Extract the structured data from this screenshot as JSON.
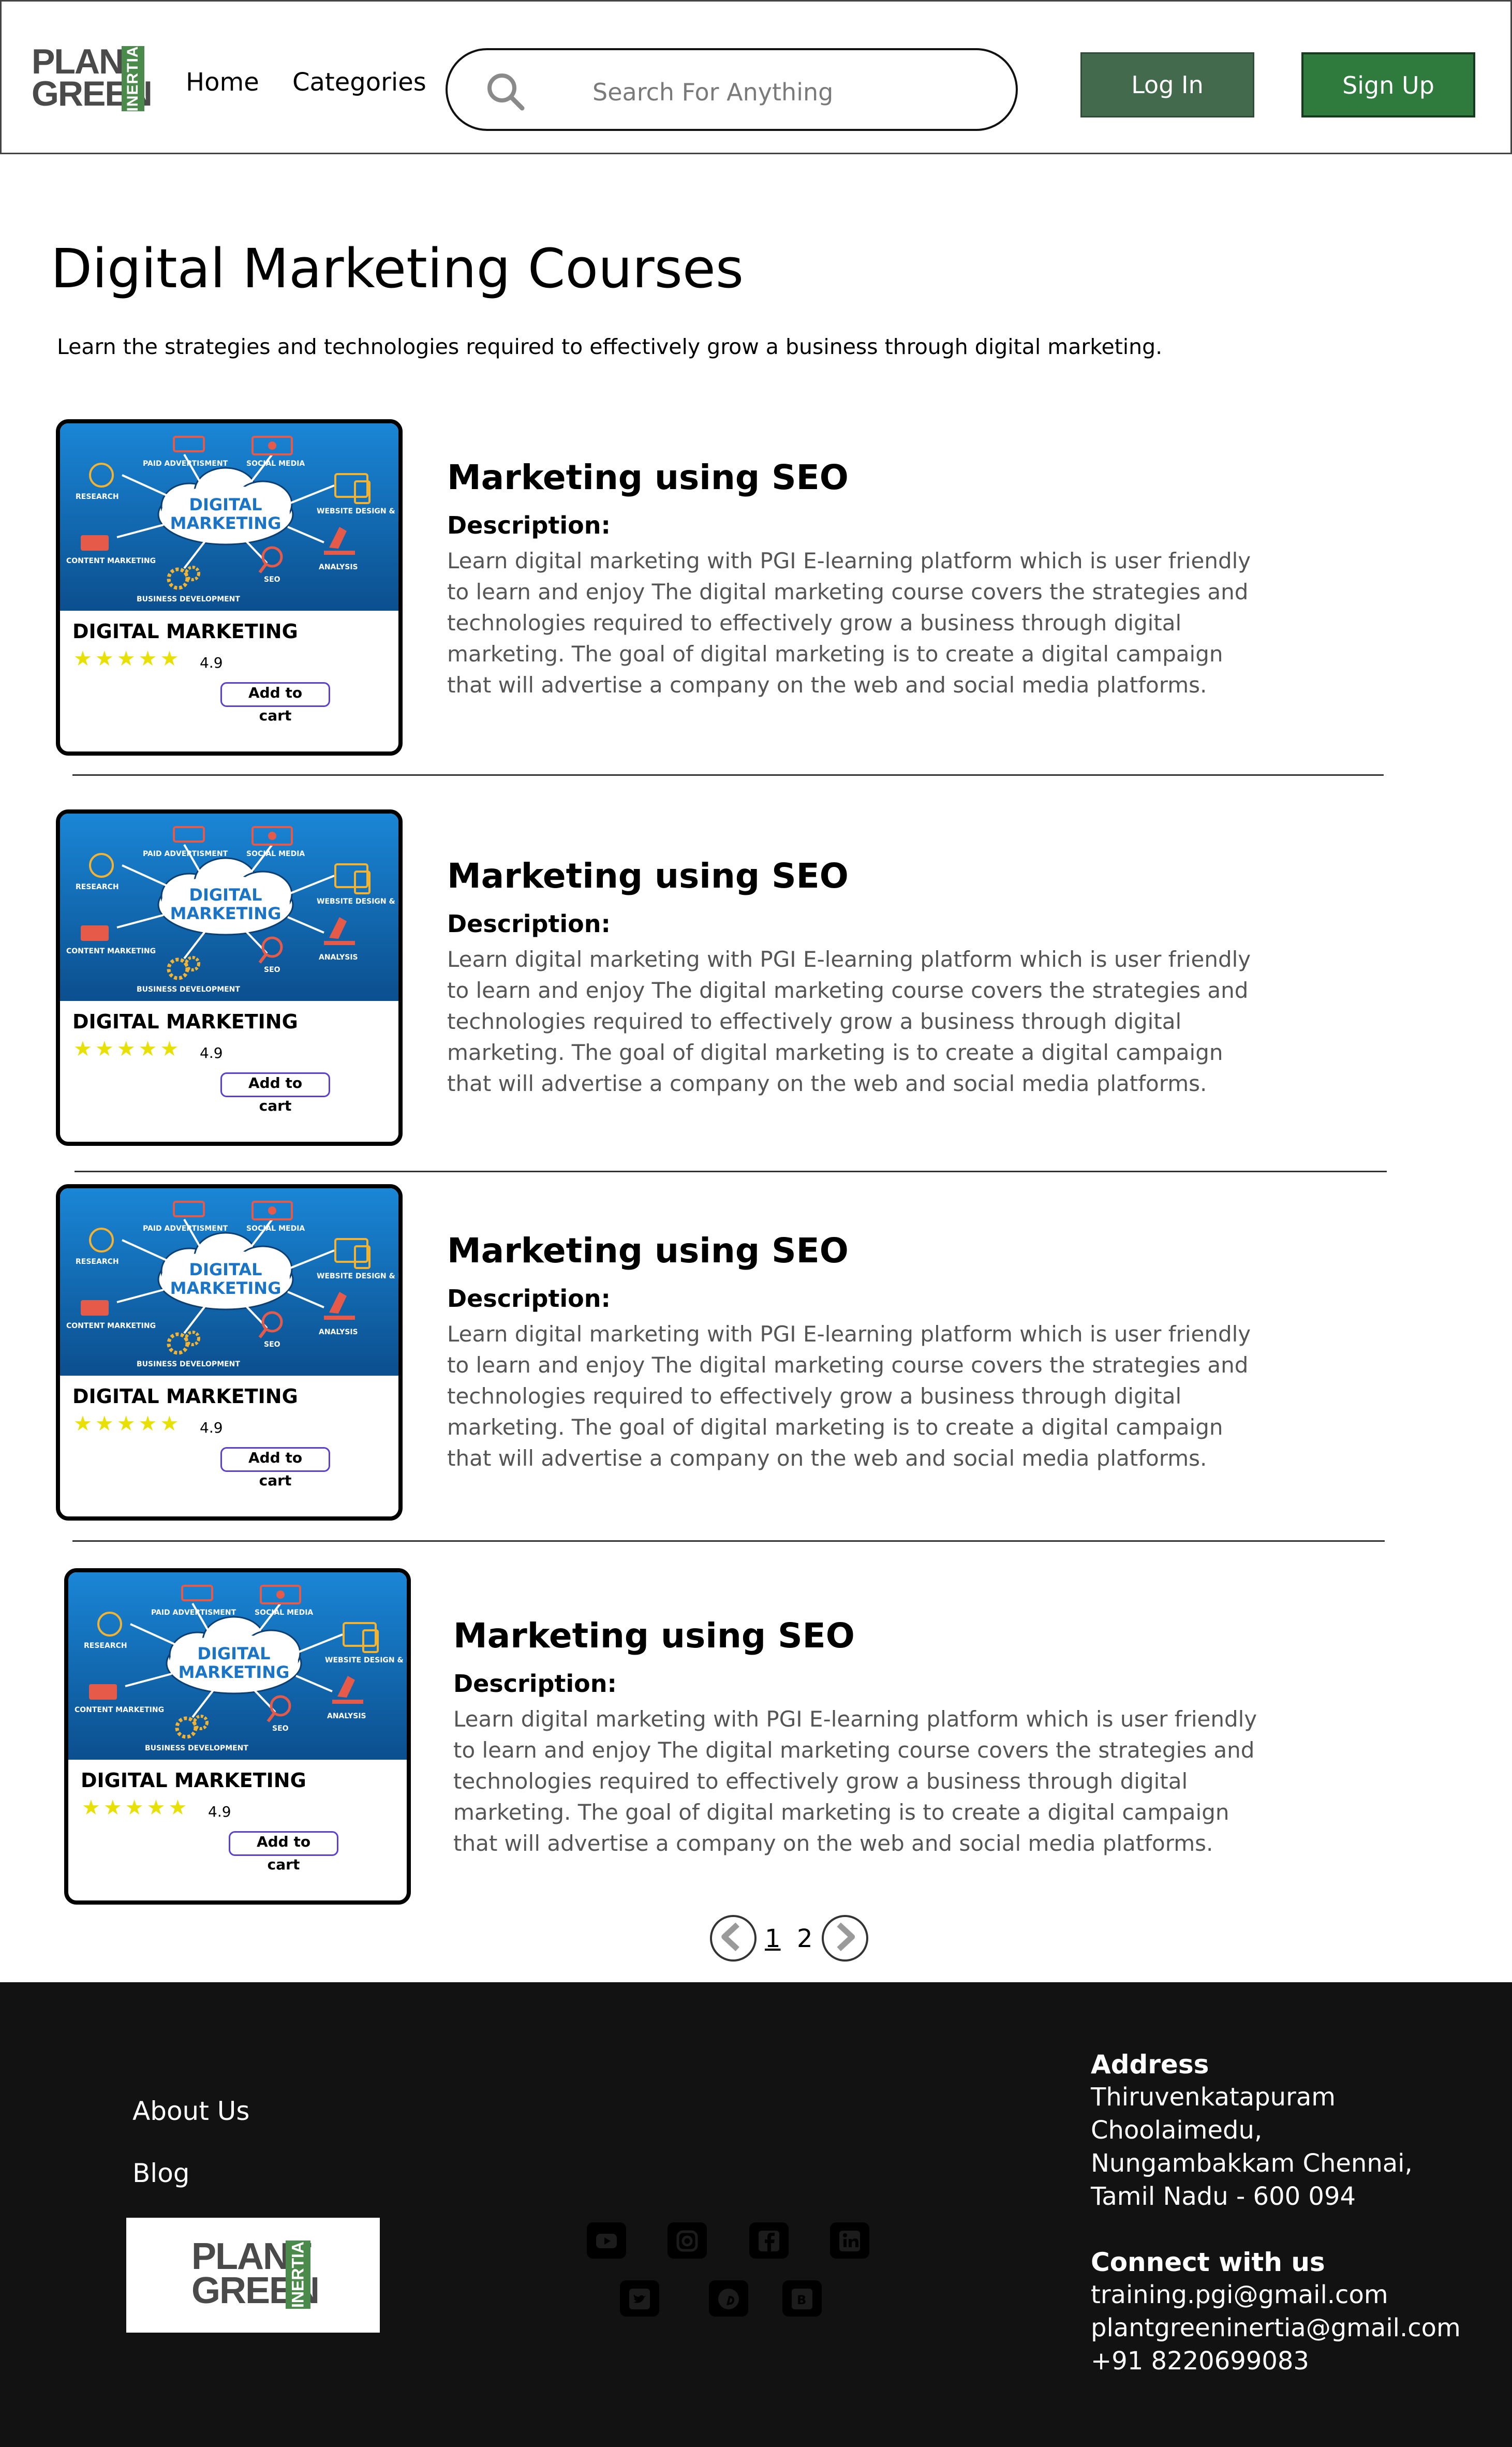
{
  "header": {
    "logo": {
      "line1": "PLANT",
      "line2": "GREEN",
      "side": "INERTIA"
    },
    "nav": [
      "Home",
      "Categories"
    ],
    "search": {
      "placeholder": "Search For Anything",
      "icon": "search-icon"
    },
    "login_label": "Log In",
    "signup_label": "Sign Up",
    "colors": {
      "login": "#436a4c",
      "signup": "#2f7a3d"
    }
  },
  "main": {
    "title": "Digital Marketing Courses",
    "subtitle": "Learn the strategies and technologies required to effectively grow a business through digital marketing.",
    "courses": [
      {
        "card_title": "DIGITAL MARKETING",
        "rating": "4.9",
        "stars": "★★★★★",
        "cart_label": "Add to cart",
        "title": "Marketing using SEO",
        "desc_label": "Description:",
        "description": "Learn digital marketing with PGI E-learning platform which is user friendly to learn and enjoy The digital marketing course covers the strategies and technologies required to effectively grow a business through digital marketing. The goal of digital marketing is to create a digital campaign that will advertise a company on the web and social media platforms."
      },
      {
        "card_title": "DIGITAL MARKETING",
        "rating": "4.9",
        "stars": "★★★★★",
        "cart_label": "Add to cart",
        "title": "Marketing using SEO",
        "desc_label": "Description:",
        "description": "Learn digital marketing with PGI E-learning platform which is user friendly to learn and enjoy The digital marketing course covers the strategies and technologies required to effectively grow a business through digital marketing. The goal of digital marketing is to create a digital campaign that will advertise a company on the web and social media platforms."
      },
      {
        "card_title": "DIGITAL MARKETING",
        "rating": "4.9",
        "stars": "★★★★★",
        "cart_label": "Add to cart",
        "title": "Marketing using SEO",
        "desc_label": "Description:",
        "description": "Learn digital marketing with PGI E-learning platform which is user friendly to learn and enjoy The digital marketing course covers the strategies and technologies required to effectively grow a business through digital marketing. The goal of digital marketing is to create a digital campaign that will advertise a company on the web and social media platforms."
      },
      {
        "card_title": "DIGITAL MARKETING",
        "rating": "4.9",
        "stars": "★★★★★",
        "cart_label": "Add to cart",
        "title": "Marketing using SEO",
        "desc_label": "Description:",
        "description": "Learn digital marketing with PGI E-learning platform which is user friendly to learn and enjoy The digital marketing course covers the strategies and technologies required to effectively grow a business through digital marketing. The goal of digital marketing is to create a digital campaign that will advertise a company on the web and social media platforms."
      }
    ],
    "thumb_labels": {
      "center": "DIGITAL MARKETING",
      "paid": "PAID ADVERTISMENT",
      "social": "SOCIAL MEDIA",
      "research": "RESEARCH",
      "website": "WEBSITE DESIGN & DEVELOPMENT",
      "content": "CONTENT MARKETING",
      "analysis": "ANALYSIS",
      "seo": "SEO",
      "business": "BUSINESS DEVELOPMENT"
    }
  },
  "pagination": {
    "prev_icon": "chevron-left-icon",
    "pages": [
      "1",
      "2"
    ],
    "current": "1",
    "next_icon": "chevron-right-icon"
  },
  "footer": {
    "links": [
      "About  Us",
      "Blog"
    ],
    "social_icons": [
      "youtube-icon",
      "instagram-icon",
      "facebook-icon",
      "linkedin-icon",
      "twitter-icon",
      "pinterest-icon",
      "blogger-icon"
    ],
    "address_heading": "Address",
    "address_lines": [
      "Thiruvenkatapuram",
      "Choolaimedu,",
      "Nungambakkam Chennai,",
      "Tamil Nadu - 600 094"
    ],
    "connect_heading": "Connect with us",
    "contacts": [
      "training.pgi@gmail.com",
      "plantgreeninertia@gmail.com",
      "+91 8220699083"
    ]
  }
}
